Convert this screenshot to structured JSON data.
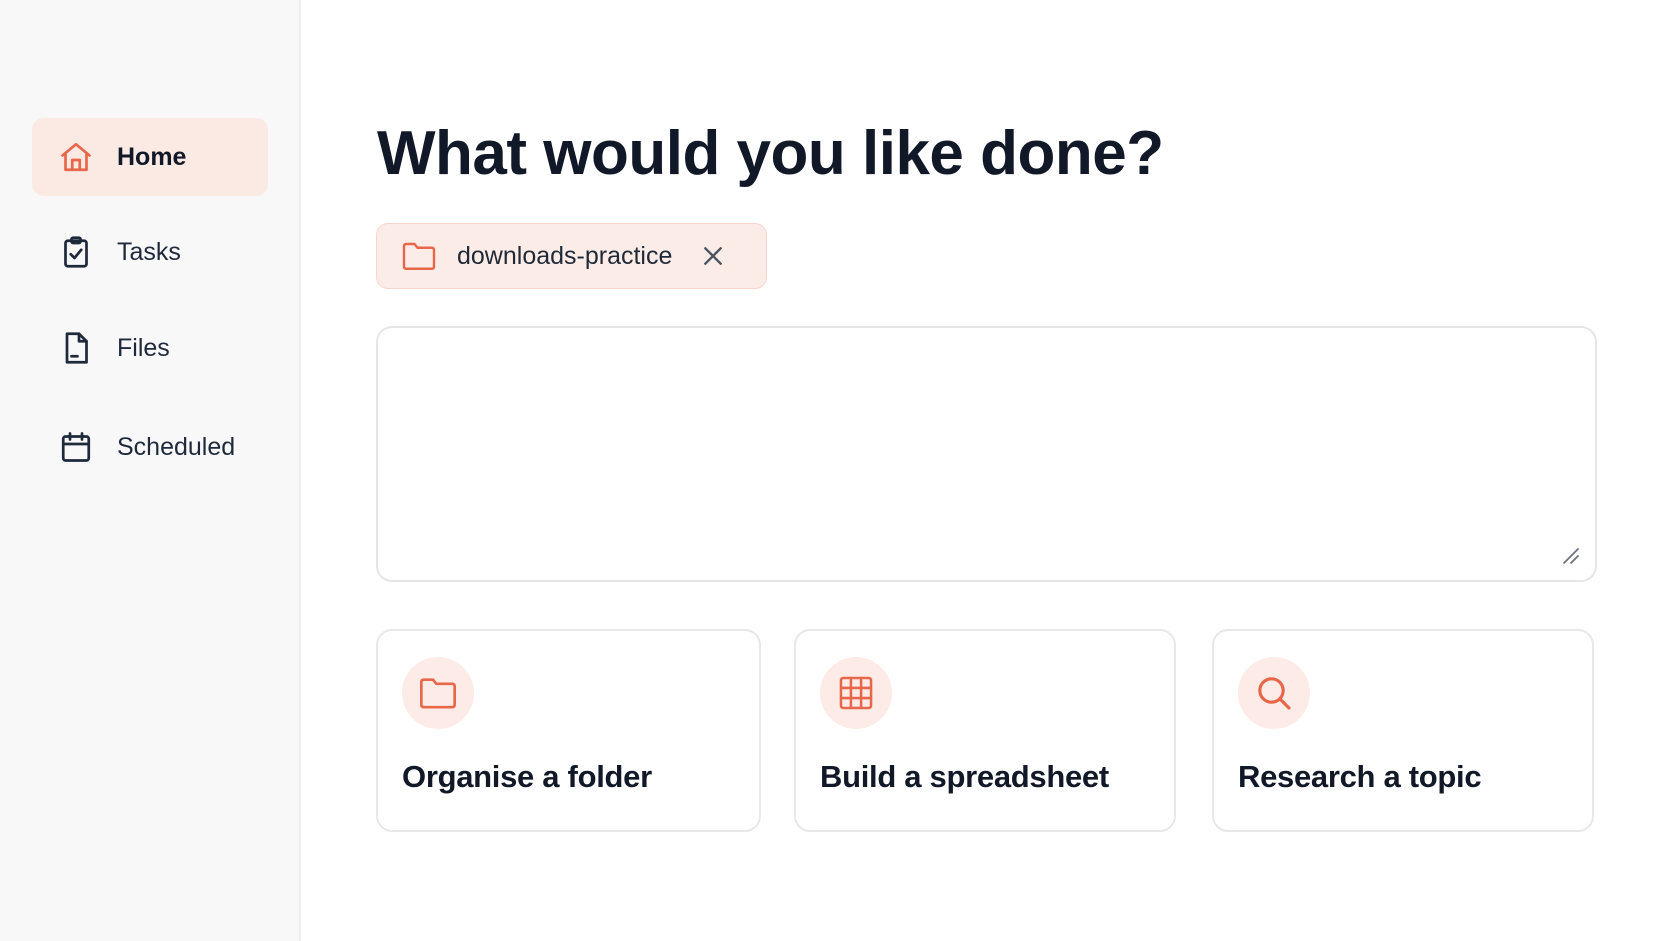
{
  "sidebar": {
    "items": [
      {
        "label": "Home",
        "icon": "home-icon",
        "active": true
      },
      {
        "label": "Tasks",
        "icon": "clipboard-check-icon",
        "active": false
      },
      {
        "label": "Files",
        "icon": "file-icon",
        "active": false
      },
      {
        "label": "Scheduled",
        "icon": "calendar-icon",
        "active": false
      }
    ]
  },
  "main": {
    "title": "What would you like done?",
    "folder_chip": {
      "label": "downloads-practice",
      "icon": "folder-icon",
      "close_icon": "close-icon"
    },
    "prompt": {
      "value": "",
      "placeholder": ""
    },
    "suggestions": [
      {
        "label": "Organise a folder",
        "icon": "folder-icon"
      },
      {
        "label": "Build a spreadsheet",
        "icon": "table-grid-icon"
      },
      {
        "label": "Research a topic",
        "icon": "search-icon"
      }
    ]
  },
  "colors": {
    "accent": "#e8674a",
    "accent_soft": "#fcebe6",
    "text_primary": "#111827",
    "border": "#e6e6e6"
  }
}
